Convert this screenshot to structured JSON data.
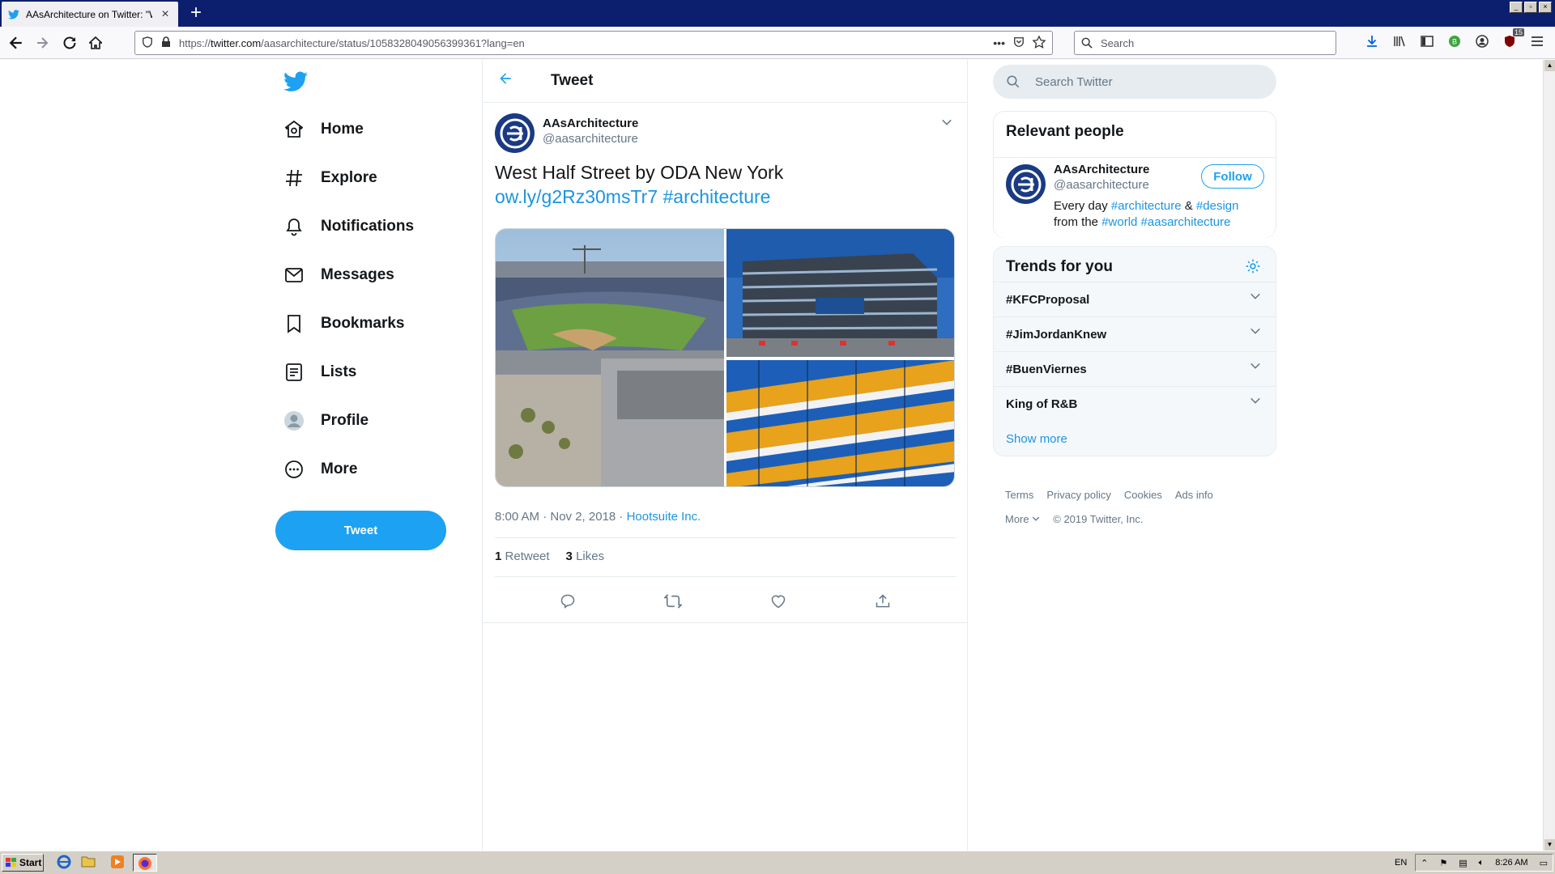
{
  "browser": {
    "tab_title": "AAsArchitecture on Twitter: \"West",
    "url_prefix": "https://",
    "url_domain": "twitter.com",
    "url_path": "/aasarchitecture/status/1058328049056399361?lang=en",
    "search_placeholder": "Search",
    "addon_badge": "15"
  },
  "nav": {
    "items": [
      {
        "label": "Home",
        "icon": "home-icon"
      },
      {
        "label": "Explore",
        "icon": "hashtag-icon"
      },
      {
        "label": "Notifications",
        "icon": "bell-icon"
      },
      {
        "label": "Messages",
        "icon": "envelope-icon"
      },
      {
        "label": "Bookmarks",
        "icon": "bookmark-icon"
      },
      {
        "label": "Lists",
        "icon": "list-icon"
      },
      {
        "label": "Profile",
        "icon": "profile-icon"
      },
      {
        "label": "More",
        "icon": "more-icon"
      }
    ],
    "tweet_button": "Tweet"
  },
  "main": {
    "header": "Tweet",
    "author_name": "AAsArchitecture",
    "author_handle": "@aasarchitecture",
    "text": "West Half Street by ODA New York",
    "link": "ow.ly/g2Rz30msTr7",
    "hashtag": "#architecture",
    "time": "8:00 AM · Nov 2, 2018 · ",
    "source": "Hootsuite Inc.",
    "retweets_count": "1",
    "retweets_label": "Retweet",
    "likes_count": "3",
    "likes_label": "Likes"
  },
  "right": {
    "search_placeholder": "Search Twitter",
    "relevant_title": "Relevant people",
    "person_name": "AAsArchitecture",
    "person_handle": "@aasarchitecture",
    "follow_label": "Follow",
    "bio_1": "Every day ",
    "bio_tag1": "#architecture",
    "bio_amp": " & ",
    "bio_tag2": "#design",
    "bio_2": "from the ",
    "bio_tag3": "#world",
    "bio_tag4": "#aasarchitecture",
    "trends_title": "Trends for you",
    "trends": [
      "#KFCProposal",
      "#JimJordanKnew",
      "#BuenViernes",
      "King of R&B"
    ],
    "show_more": "Show more",
    "footer_links": [
      "Terms",
      "Privacy policy",
      "Cookies",
      "Ads info"
    ],
    "footer_more": "More",
    "copyright": "© 2019 Twitter, Inc."
  },
  "taskbar": {
    "start": "Start",
    "lang": "EN",
    "clock": "8:26 AM"
  },
  "colors": {
    "twitter_blue": "#1da1f2",
    "link_blue": "#1b95e0",
    "titlebar": "#0c1f6e"
  }
}
